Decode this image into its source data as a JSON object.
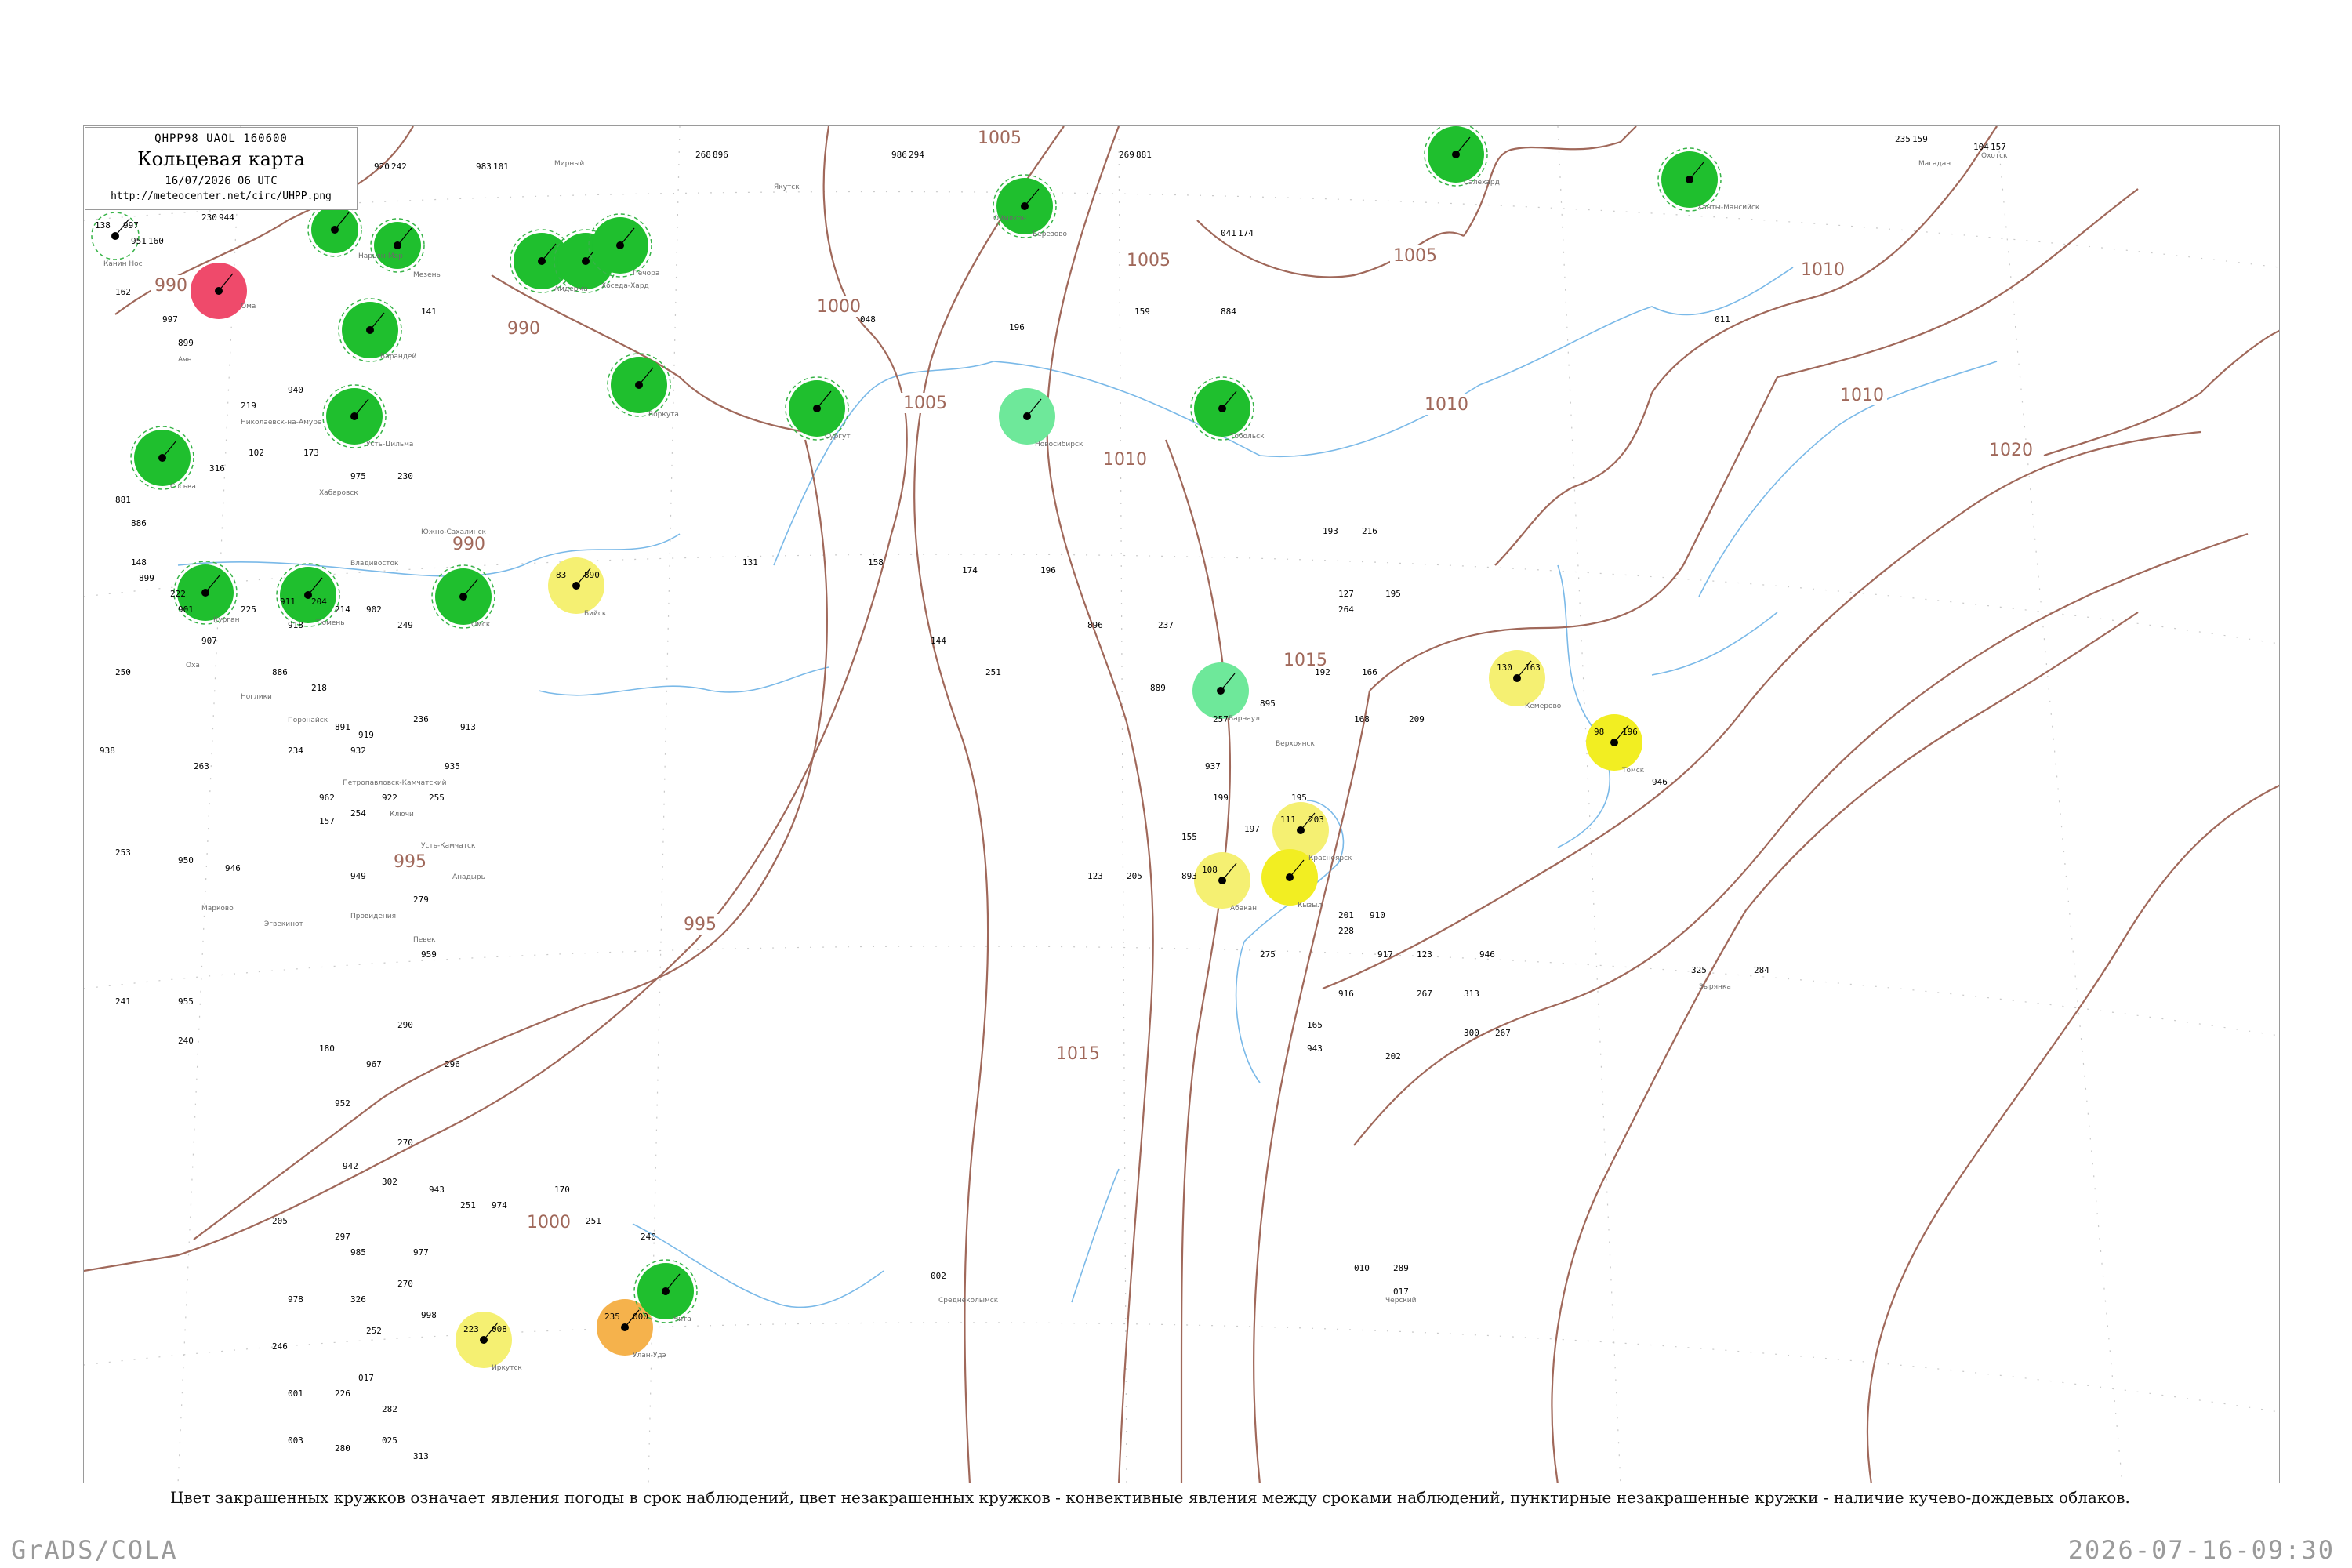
{
  "title": {
    "code": "QHPP98  UAOL  160600",
    "main": "Кольцевая карта",
    "date": "16/07/2026 06 UTC",
    "url": "http://meteocenter.net/circ/UHPP.png"
  },
  "caption": "Цвет закрашенных кружков означает явления погоды в срок наблюдений, цвет незакрашенных кружков - конвективные явления между сроками наблюдений, пунктирные незакрашенные кружки - наличие кучево-дождевых облаков.",
  "footer": {
    "left": "GrADS/COLA",
    "right": "2026-07-16-09:30"
  },
  "colors": {
    "isobar": "#a0685a",
    "coast": "#7ab9e8",
    "green": "#1fbf2e",
    "light_green": "#6ee89a",
    "yellow": "#f5f072",
    "bright_yellow": "#f2ee22",
    "orange": "#f5b24c",
    "red": "#ef4a6b",
    "dashed_ring": "#37b347"
  },
  "isobar_labels": [
    "990",
    "990",
    "990",
    "995",
    "995",
    "1000",
    "1000",
    "1005",
    "1005",
    "1005",
    "1005",
    "1010",
    "1010",
    "1010",
    "1010",
    "1015",
    "1015",
    "1020"
  ],
  "stations": [
    {
      "pressure": "997",
      "temp": "138",
      "circle": "dashed"
    },
    {
      "pressure": "",
      "temp": "",
      "circle": "red"
    },
    {
      "pressure": "",
      "temp": "",
      "circle": "green"
    },
    {
      "pressure": "",
      "temp": "",
      "circle": "green"
    },
    {
      "pressure": "",
      "temp": "",
      "circle": "green"
    },
    {
      "pressure": "",
      "temp": "",
      "circle": "green"
    },
    {
      "pressure": "",
      "temp": "",
      "circle": "green"
    },
    {
      "pressure": "",
      "temp": "",
      "circle": "green"
    },
    {
      "pressure": "",
      "temp": "",
      "circle": "green"
    },
    {
      "pressure": "",
      "temp": "",
      "circle": "green"
    },
    {
      "pressure": "",
      "temp": "",
      "circle": "green"
    },
    {
      "pressure": "",
      "temp": "",
      "circle": "green"
    },
    {
      "pressure": "",
      "temp": "",
      "circle": "green"
    },
    {
      "pressure": "",
      "temp": "",
      "circle": "green"
    },
    {
      "pressure": "",
      "temp": "",
      "circle": "green"
    },
    {
      "pressure": "",
      "temp": "",
      "circle": "green"
    },
    {
      "pressure": "",
      "temp": "",
      "circle": "green"
    },
    {
      "pressure": "",
      "temp": "",
      "circle": "green"
    },
    {
      "pressure": "",
      "temp": "",
      "circle": "green"
    },
    {
      "pressure": "",
      "temp": "",
      "circle": "light_green"
    },
    {
      "pressure": "",
      "temp": "",
      "circle": "light_green"
    },
    {
      "pressure": "890",
      "temp": "83",
      "circle": "yellow"
    },
    {
      "pressure": "163",
      "temp": "130",
      "circle": "yellow"
    },
    {
      "pressure": "196",
      "temp": "98",
      "circle": "bright_yellow"
    },
    {
      "pressure": "203",
      "temp": "111",
      "circle": "yellow"
    },
    {
      "pressure": "",
      "temp": "108",
      "circle": "yellow"
    },
    {
      "pressure": "",
      "temp": "",
      "circle": "bright_yellow"
    },
    {
      "pressure": "008",
      "temp": "223",
      "circle": "yellow"
    },
    {
      "pressure": "000",
      "temp": "235",
      "circle": "orange"
    },
    {
      "pressure": "",
      "temp": "",
      "circle": "green"
    }
  ],
  "plain_numbers": [
    "920",
    "230",
    "951",
    "958",
    "983",
    "268",
    "986",
    "269",
    "041",
    "235",
    "104",
    "162",
    "997",
    "219",
    "940",
    "899",
    "141",
    "048",
    "196",
    "159",
    "884",
    "011",
    "316",
    "102",
    "173",
    "975",
    "230",
    "881",
    "886",
    "148",
    "899",
    "222",
    "901",
    "907",
    "225",
    "911",
    "918",
    "204",
    "214",
    "902",
    "249",
    "250",
    "886",
    "218",
    "891",
    "919",
    "236",
    "913",
    "234",
    "932",
    "935",
    "938",
    "263",
    "962",
    "254",
    "922",
    "255",
    "157",
    "253",
    "950",
    "946",
    "949",
    "279",
    "959",
    "241",
    "955",
    "240",
    "180",
    "967",
    "290",
    "296",
    "952",
    "270",
    "942",
    "302",
    "943",
    "251",
    "974",
    "170",
    "251",
    "240",
    "205",
    "297",
    "985",
    "977",
    "270",
    "978",
    "326",
    "252",
    "998",
    "246",
    "001",
    "226",
    "017",
    "282",
    "003",
    "280",
    "025",
    "313",
    "010",
    "289",
    "017",
    "325",
    "284",
    "002",
    "199",
    "195",
    "197",
    "155",
    "216",
    "193",
    "192",
    "166",
    "168",
    "209",
    "127",
    "195",
    "264",
    "131",
    "158",
    "174",
    "196",
    "144",
    "251",
    "896",
    "237",
    "889",
    "257",
    "895",
    "201",
    "910",
    "228",
    "917",
    "123",
    "267",
    "313",
    "300",
    "267",
    "916",
    "165",
    "943",
    "202",
    "946",
    "275",
    "946",
    "937",
    "893",
    "123",
    "205",
    "242",
    "944",
    "160",
    "102",
    "101",
    "896",
    "294",
    "881",
    "174",
    "159",
    "157"
  ],
  "station_names": [
    "Канин Нос",
    "Ома",
    "Нарьян-Мар",
    "Мезень",
    "Варандей",
    "Усть-Цильма",
    "Амдерма",
    "Хоседа-Хард",
    "Печора",
    "Воркута",
    "Сосьва",
    "Березово",
    "Салехард",
    "Ханты-Мансийск",
    "Сургут",
    "Тобольск",
    "Тюмень",
    "Курган",
    "Омск",
    "Новосибирск",
    "Барнаул",
    "Бийск",
    "Кемерово",
    "Томск",
    "Красноярск",
    "Абакан",
    "Кызыл",
    "Иркутск",
    "Улан-Удэ",
    "Чита",
    "Мирный",
    "Якутск",
    "Оймякон",
    "Магадан",
    "Охотск",
    "Аян",
    "Николаевск-на-Амуре",
    "Хабаровск",
    "Владивосток",
    "Южно-Сахалинск",
    "Оха",
    "Ноглики",
    "Поронайск",
    "Петропавловск-Камчатский",
    "Ключи",
    "Усть-Камчатск",
    "Анадырь",
    "Марково",
    "Эгвекинот",
    "Провидения",
    "Певек",
    "Черский",
    "Зырянка",
    "Среднеколымск",
    "Верхоянск"
  ]
}
